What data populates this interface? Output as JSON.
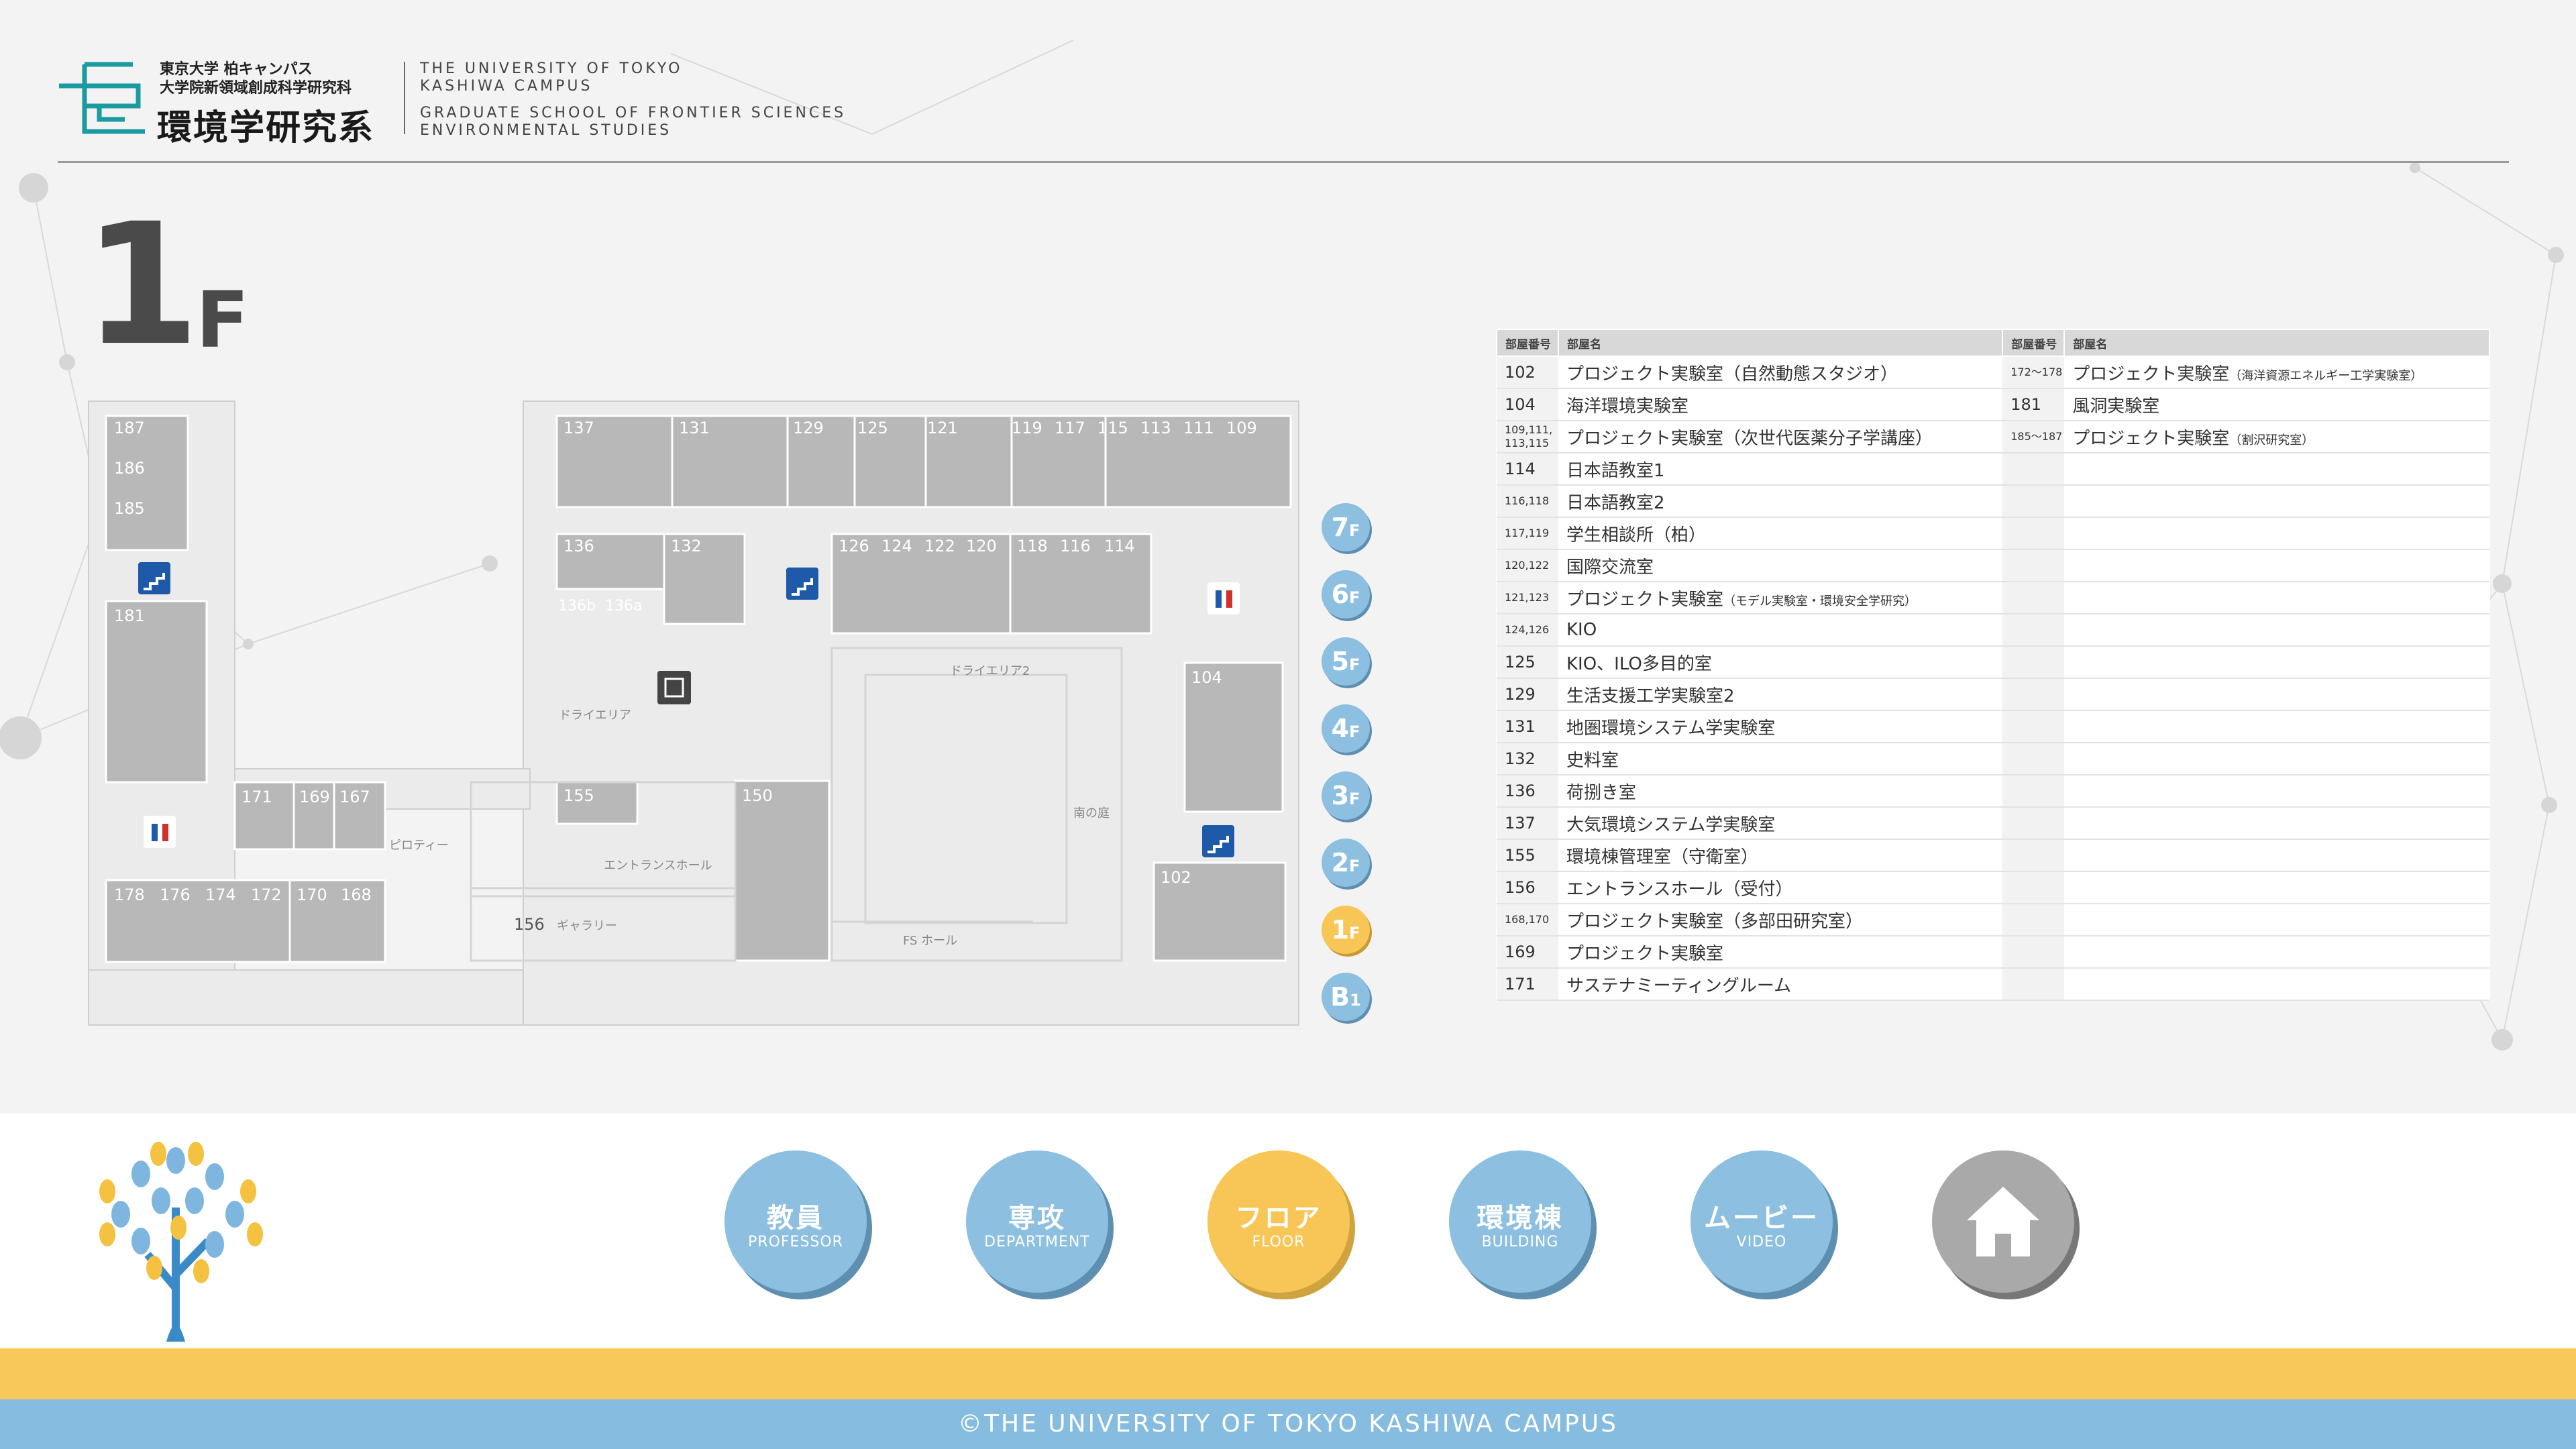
{
  "header": {
    "logo_small_1": "東京大学 柏キャンパス",
    "logo_small_2": "大学院新領域創成科学研究科",
    "logo_big": "環境学研究系",
    "en_1": "THE UNIVERSITY OF TOKYO",
    "en_2": "KASHIWA CAMPUS",
    "en_3": "GRADUATE SCHOOL OF FRONTIER SCIENCES",
    "en_4": "ENVIRONMENTAL STUDIES"
  },
  "floor": {
    "number": "1",
    "unit": "F"
  },
  "map": {
    "rooms_top": [
      "137",
      "131",
      "129",
      "125",
      "121",
      "119",
      "117",
      "115",
      "113",
      "111",
      "109"
    ],
    "rooms_mid": [
      "126",
      "124",
      "122",
      "120",
      "118",
      "116",
      "114"
    ],
    "rooms_left": [
      "187",
      "186",
      "185",
      "181"
    ],
    "rooms_west": [
      "171",
      "169",
      "167",
      "178",
      "176",
      "174",
      "172",
      "170",
      "168"
    ],
    "rooms_center": [
      "136",
      "132",
      "136b",
      "136a",
      "155",
      "150",
      "104",
      "102",
      "156"
    ],
    "areas": {
      "dry1": "ドライエリア",
      "dry2": "ドライエリア2",
      "piloti": "ピロティー",
      "entrance": "エントランスホール",
      "gallery": "ギャラリー",
      "fshall": "FS ホール",
      "south_garden": "南の庭"
    }
  },
  "floor_buttons": [
    {
      "label": "7",
      "unit": "F"
    },
    {
      "label": "6",
      "unit": "F"
    },
    {
      "label": "5",
      "unit": "F"
    },
    {
      "label": "4",
      "unit": "F"
    },
    {
      "label": "3",
      "unit": "F"
    },
    {
      "label": "2",
      "unit": "F"
    },
    {
      "label": "1",
      "unit": "F",
      "active": true
    },
    {
      "label": "B",
      "unit": "1"
    }
  ],
  "table": {
    "col_no": "部屋番号",
    "col_name": "部屋名",
    "left_rows": [
      {
        "no": "102",
        "name": "プロジェクト実験室（自然動態スタジオ）"
      },
      {
        "no": "104",
        "name": "海洋環境実験室"
      },
      {
        "no": "109,111,\n113,115",
        "name": "プロジェクト実験室（次世代医薬分子学講座）"
      },
      {
        "no": "114",
        "name": "日本語教室1"
      },
      {
        "no": "116,118",
        "name": "日本語教室2"
      },
      {
        "no": "117,119",
        "name": "学生相談所（柏）"
      },
      {
        "no": "120,122",
        "name": "国際交流室"
      },
      {
        "no": "121,123",
        "name": "プロジェクト実験室",
        "sub": "（モデル実験室・環境安全学研究）"
      },
      {
        "no": "124,126",
        "name": "KIO"
      },
      {
        "no": "125",
        "name": "KIO、ILO多目的室"
      },
      {
        "no": "129",
        "name": "生活支援工学実験室2"
      },
      {
        "no": "131",
        "name": "地圏環境システム学実験室"
      },
      {
        "no": "132",
        "name": "史料室"
      },
      {
        "no": "136",
        "name": "荷捌き室"
      },
      {
        "no": "137",
        "name": "大気環境システム学実験室"
      },
      {
        "no": "155",
        "name": "環境棟管理室（守衛室）"
      },
      {
        "no": "156",
        "name": "エントランスホール（受付）"
      },
      {
        "no": "168,170",
        "name": "プロジェクト実験室（多部田研究室）"
      },
      {
        "no": "169",
        "name": "プロジェクト実験室"
      },
      {
        "no": "171",
        "name": "サステナミーティングルーム"
      }
    ],
    "right_rows": [
      {
        "no": "172～178",
        "name": "プロジェクト実験室",
        "sub": "（海洋資源エネルギー工学実験室）"
      },
      {
        "no": "181",
        "name": "風洞実験室"
      },
      {
        "no": "185～187",
        "name": "プロジェクト実験室",
        "sub": "（割沢研究室）"
      }
    ]
  },
  "nav": [
    {
      "ja": "教員",
      "en": "PROFESSOR"
    },
    {
      "ja": "専攻",
      "en": "DEPARTMENT"
    },
    {
      "ja": "フロア",
      "en": "FLOOR",
      "active": true
    },
    {
      "ja": "環境棟",
      "en": "BUILDING"
    },
    {
      "ja": "ムービー",
      "en": "VIDEO"
    }
  ],
  "footer": "©THE UNIVERSITY OF TOKYO KASHIWA CAMPUS",
  "colors": {
    "accent_blue": "#8dbfe0",
    "accent_yellow": "#f7c657",
    "logo_teal": "#1b9aa0"
  }
}
